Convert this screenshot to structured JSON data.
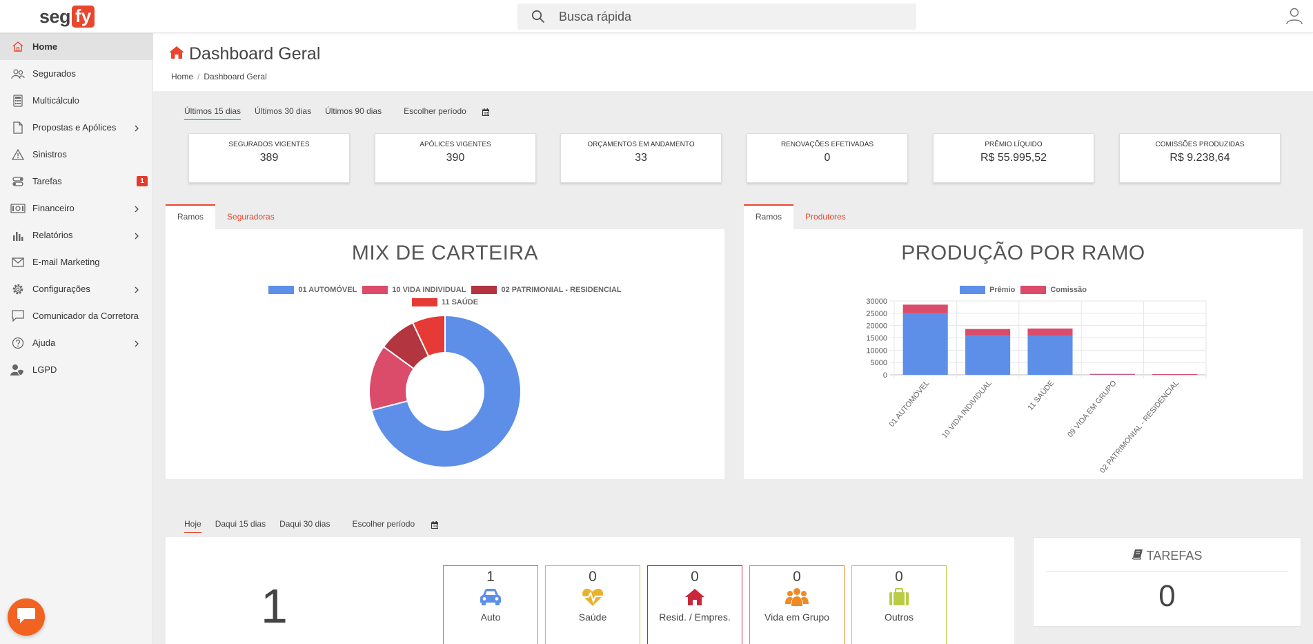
{
  "colors": {
    "accent": "#e8462e",
    "blue": "#5d8fe8",
    "pink": "#db4b6a",
    "darkred": "#b2353f",
    "red": "#e53a35",
    "orange": "#f08a24",
    "yellow": "#e9b22b",
    "lime": "#b8cc46"
  },
  "header": {
    "logo_a": "seg",
    "logo_b": "fy",
    "search_placeholder": "Busca rápida"
  },
  "sidebar": {
    "items": [
      {
        "label": "Home",
        "icon": "home-icon"
      },
      {
        "label": "Segurados",
        "icon": "users-icon"
      },
      {
        "label": "Multicálculo",
        "icon": "calculator-icon"
      },
      {
        "label": "Propostas e Apólices",
        "icon": "document-icon"
      },
      {
        "label": "Sinistros",
        "icon": "warning-icon"
      },
      {
        "label": "Tarefas",
        "icon": "tasks-icon",
        "badge": "1"
      },
      {
        "label": "Financeiro",
        "icon": "money-icon"
      },
      {
        "label": "Relatórios",
        "icon": "bar-chart-icon"
      },
      {
        "label": "E-mail Marketing",
        "icon": "mail-icon"
      },
      {
        "label": "Configurações",
        "icon": "gear-icon"
      },
      {
        "label": "Comunicador da Corretora",
        "icon": "chat-icon"
      },
      {
        "label": "Ajuda",
        "icon": "help-icon"
      },
      {
        "label": "LGPD",
        "icon": "user-shield-icon"
      }
    ]
  },
  "page": {
    "title": "Dashboard Geral",
    "breadcrumb": [
      "Home",
      "Dashboard Geral"
    ]
  },
  "periods": {
    "options": [
      "Últimos 15 dias",
      "Últimos 30 dias",
      "Últimos 90 dias"
    ],
    "custom": "Escolher período"
  },
  "kpis": [
    {
      "title": "SEGURADOS VIGENTES",
      "value": "389"
    },
    {
      "title": "APÓLICES VIGENTES",
      "value": "390"
    },
    {
      "title": "ORÇAMENTOS EM ANDAMENTO",
      "value": "33"
    },
    {
      "title": "RENOVAÇÕES EFETIVADAS",
      "value": "0"
    },
    {
      "title": "PRÊMIO LÍQUIDO",
      "value": "R$ 55.995,52"
    },
    {
      "title": "COMISSÕES PRODUZIDAS",
      "value": "R$ 9.238,64"
    }
  ],
  "left_panel": {
    "tabs": [
      "Ramos",
      "Seguradoras"
    ]
  },
  "right_panel": {
    "tabs": [
      "Ramos",
      "Produtores"
    ]
  },
  "chart_data": [
    {
      "type": "pie",
      "title": "MIX DE CARTEIRA",
      "labels": [
        "01 AUTOMÓVEL",
        "10 VIDA INDIVIDUAL",
        "02 PATRIMONIAL - RESIDENCIAL",
        "11 SAÚDE"
      ],
      "values": [
        71,
        14,
        8,
        7
      ],
      "colors": [
        "#5d8fe8",
        "#db4b6a",
        "#b2353f",
        "#e53a35"
      ],
      "legend": "top"
    },
    {
      "type": "bar",
      "stacked": true,
      "title": "PRODUÇÃO POR RAMO",
      "categories": [
        "01 AUTOMÓVEL",
        "10 VIDA INDIVIDUAL",
        "11 SAÚDE",
        "09 VIDA EM GRUPO",
        "02 PATRIMONIAL - RESIDENCIAL"
      ],
      "series": [
        {
          "name": "Prêmio",
          "values": [
            25000,
            16000,
            15800,
            300,
            250
          ],
          "color": "#5d8fe8"
        },
        {
          "name": "Comissão",
          "values": [
            3500,
            2600,
            3000,
            60,
            40
          ],
          "color": "#db4b6a"
        }
      ],
      "yticks": [
        "30000",
        "25000",
        "20000",
        "15000",
        "10000",
        "5000",
        "0"
      ],
      "ylim": [
        0,
        30000
      ],
      "grid": true,
      "legend": "top"
    }
  ],
  "due_periods": {
    "options": [
      "Hoje",
      "Daqui 15 dias",
      "Daqui 30 dias"
    ],
    "custom": "Escolher período"
  },
  "renewals": {
    "total": "1",
    "categories": [
      {
        "value": "1",
        "label": "Auto",
        "icon": "car-icon"
      },
      {
        "value": "0",
        "label": "Saúde",
        "icon": "heartbeat-icon"
      },
      {
        "value": "0",
        "label": "Resid. / Empres.",
        "icon": "house-icon"
      },
      {
        "value": "0",
        "label": "Vida em Grupo",
        "icon": "group-icon"
      },
      {
        "value": "0",
        "label": "Outros",
        "icon": "briefcase-icon"
      }
    ]
  },
  "tasks": {
    "title": "TAREFAS",
    "value": "0"
  }
}
